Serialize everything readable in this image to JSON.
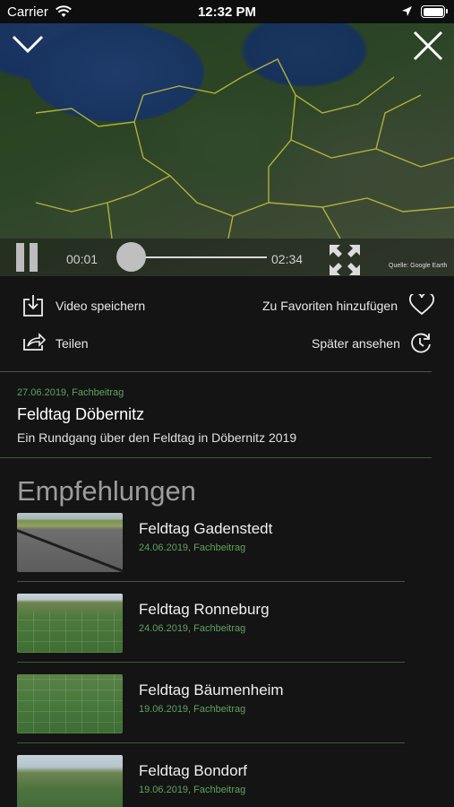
{
  "status_bar": {
    "carrier": "Carrier",
    "time": "12:32 PM"
  },
  "player": {
    "current_time": "00:01",
    "duration": "02:34",
    "progress": 0.006,
    "credit": "Quelle: Google Earth"
  },
  "actions": {
    "save": "Video speichern",
    "favorite": "Zu Favoriten hinzufügen",
    "share": "Teilen",
    "watch_later": "Später ansehen"
  },
  "video_info": {
    "meta": "27.06.2019, Fachbeitrag",
    "title": "Feldtag Döbernitz",
    "description": "Ein Rundgang über den Feldtag in Döbernitz 2019"
  },
  "recommendations": {
    "heading": "Empfehlungen",
    "items": [
      {
        "title": "Feldtag Gadenstedt",
        "meta": "24.06.2019, Fachbeitrag"
      },
      {
        "title": "Feldtag Ronneburg",
        "meta": "24.06.2019, Fachbeitrag"
      },
      {
        "title": "Feldtag Bäumenheim",
        "meta": "19.06.2019, Fachbeitrag"
      },
      {
        "title": "Feldtag Bondorf",
        "meta": "19.06.2019, Fachbeitrag"
      }
    ]
  },
  "colors": {
    "accent": "#5ea35e",
    "background": "#141414",
    "divider": "#3d5a3d"
  }
}
